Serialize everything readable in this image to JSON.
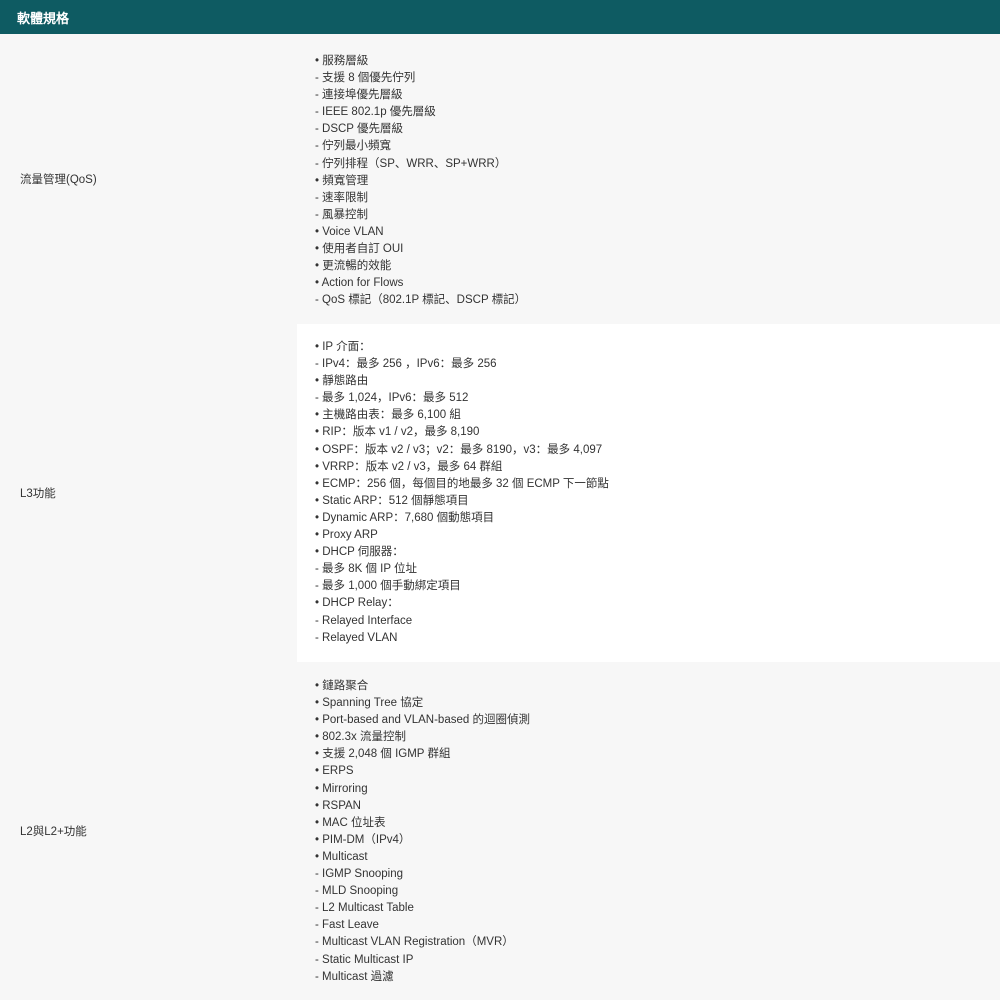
{
  "header": {
    "title": "軟體規格"
  },
  "sections": [
    {
      "label": "流量管理(QoS)",
      "items": [
        "• 服務層級",
        "- 支援 8 個優先佇列",
        "- 連接埠優先層級",
        "- IEEE 802.1p 優先層級",
        "- DSCP 優先層級",
        "- 佇列最小頻寬",
        "- 佇列排程（SP、WRR、SP+WRR）",
        "• 頻寬管理",
        "- 速率限制",
        "- 風暴控制",
        "• Voice VLAN",
        "• 使用者自訂 OUI",
        "• 更流暢的效能",
        "• Action for Flows",
        "- QoS 標記（802.1P 標記、DSCP 標記）"
      ]
    },
    {
      "label": "L3功能",
      "items": [
        "• IP 介面：",
        "- IPv4：最多 256 ，IPv6：最多 256",
        "• 靜態路由",
        "- 最多 1,024，IPv6：最多 512",
        "• 主機路由表：最多 6,100 組",
        "• RIP：版本 v1 / v2，最多 8,190",
        "• OSPF：版本 v2 / v3；v2：最多 8190，v3：最多 4,097",
        "• VRRP：版本 v2 / v3，最多 64 群組",
        "• ECMP：256 個，每個目的地最多 32 個 ECMP 下一節點",
        "• Static ARP：512 個靜態項目",
        "• Dynamic ARP：7,680 個動態項目",
        "• Proxy ARP",
        "• DHCP 伺服器：",
        "- 最多 8K 個 IP 位址",
        "- 最多 1,000 個手動綁定項目",
        "• DHCP Relay：",
        "- Relayed Interface",
        "- Relayed VLAN"
      ]
    },
    {
      "label": "L2與L2+功能",
      "items": [
        "• 鏈路聚合",
        "• Spanning Tree 協定",
        "• Port-based and VLAN-based 的迴圈偵測",
        "• 802.3x 流量控制",
        "• 支援 2,048 個 IGMP 群組",
        "• ERPS",
        "• Mirroring",
        "• RSPAN",
        "• MAC 位址表",
        "• PIM-DM（IPv4）",
        "• Multicast",
        "- IGMP Snooping",
        "- MLD Snooping",
        "- L2 Multicast Table",
        "- Fast Leave",
        "- Multicast VLAN Registration（MVR）",
        "- Static Multicast IP",
        "- Multicast 過濾"
      ]
    }
  ],
  "colors": {
    "header_bg": "#0e5b62",
    "header_text": "#ffffff",
    "row_shade": "#f7f7f7",
    "row_white": "#ffffff",
    "text": "#333333"
  }
}
